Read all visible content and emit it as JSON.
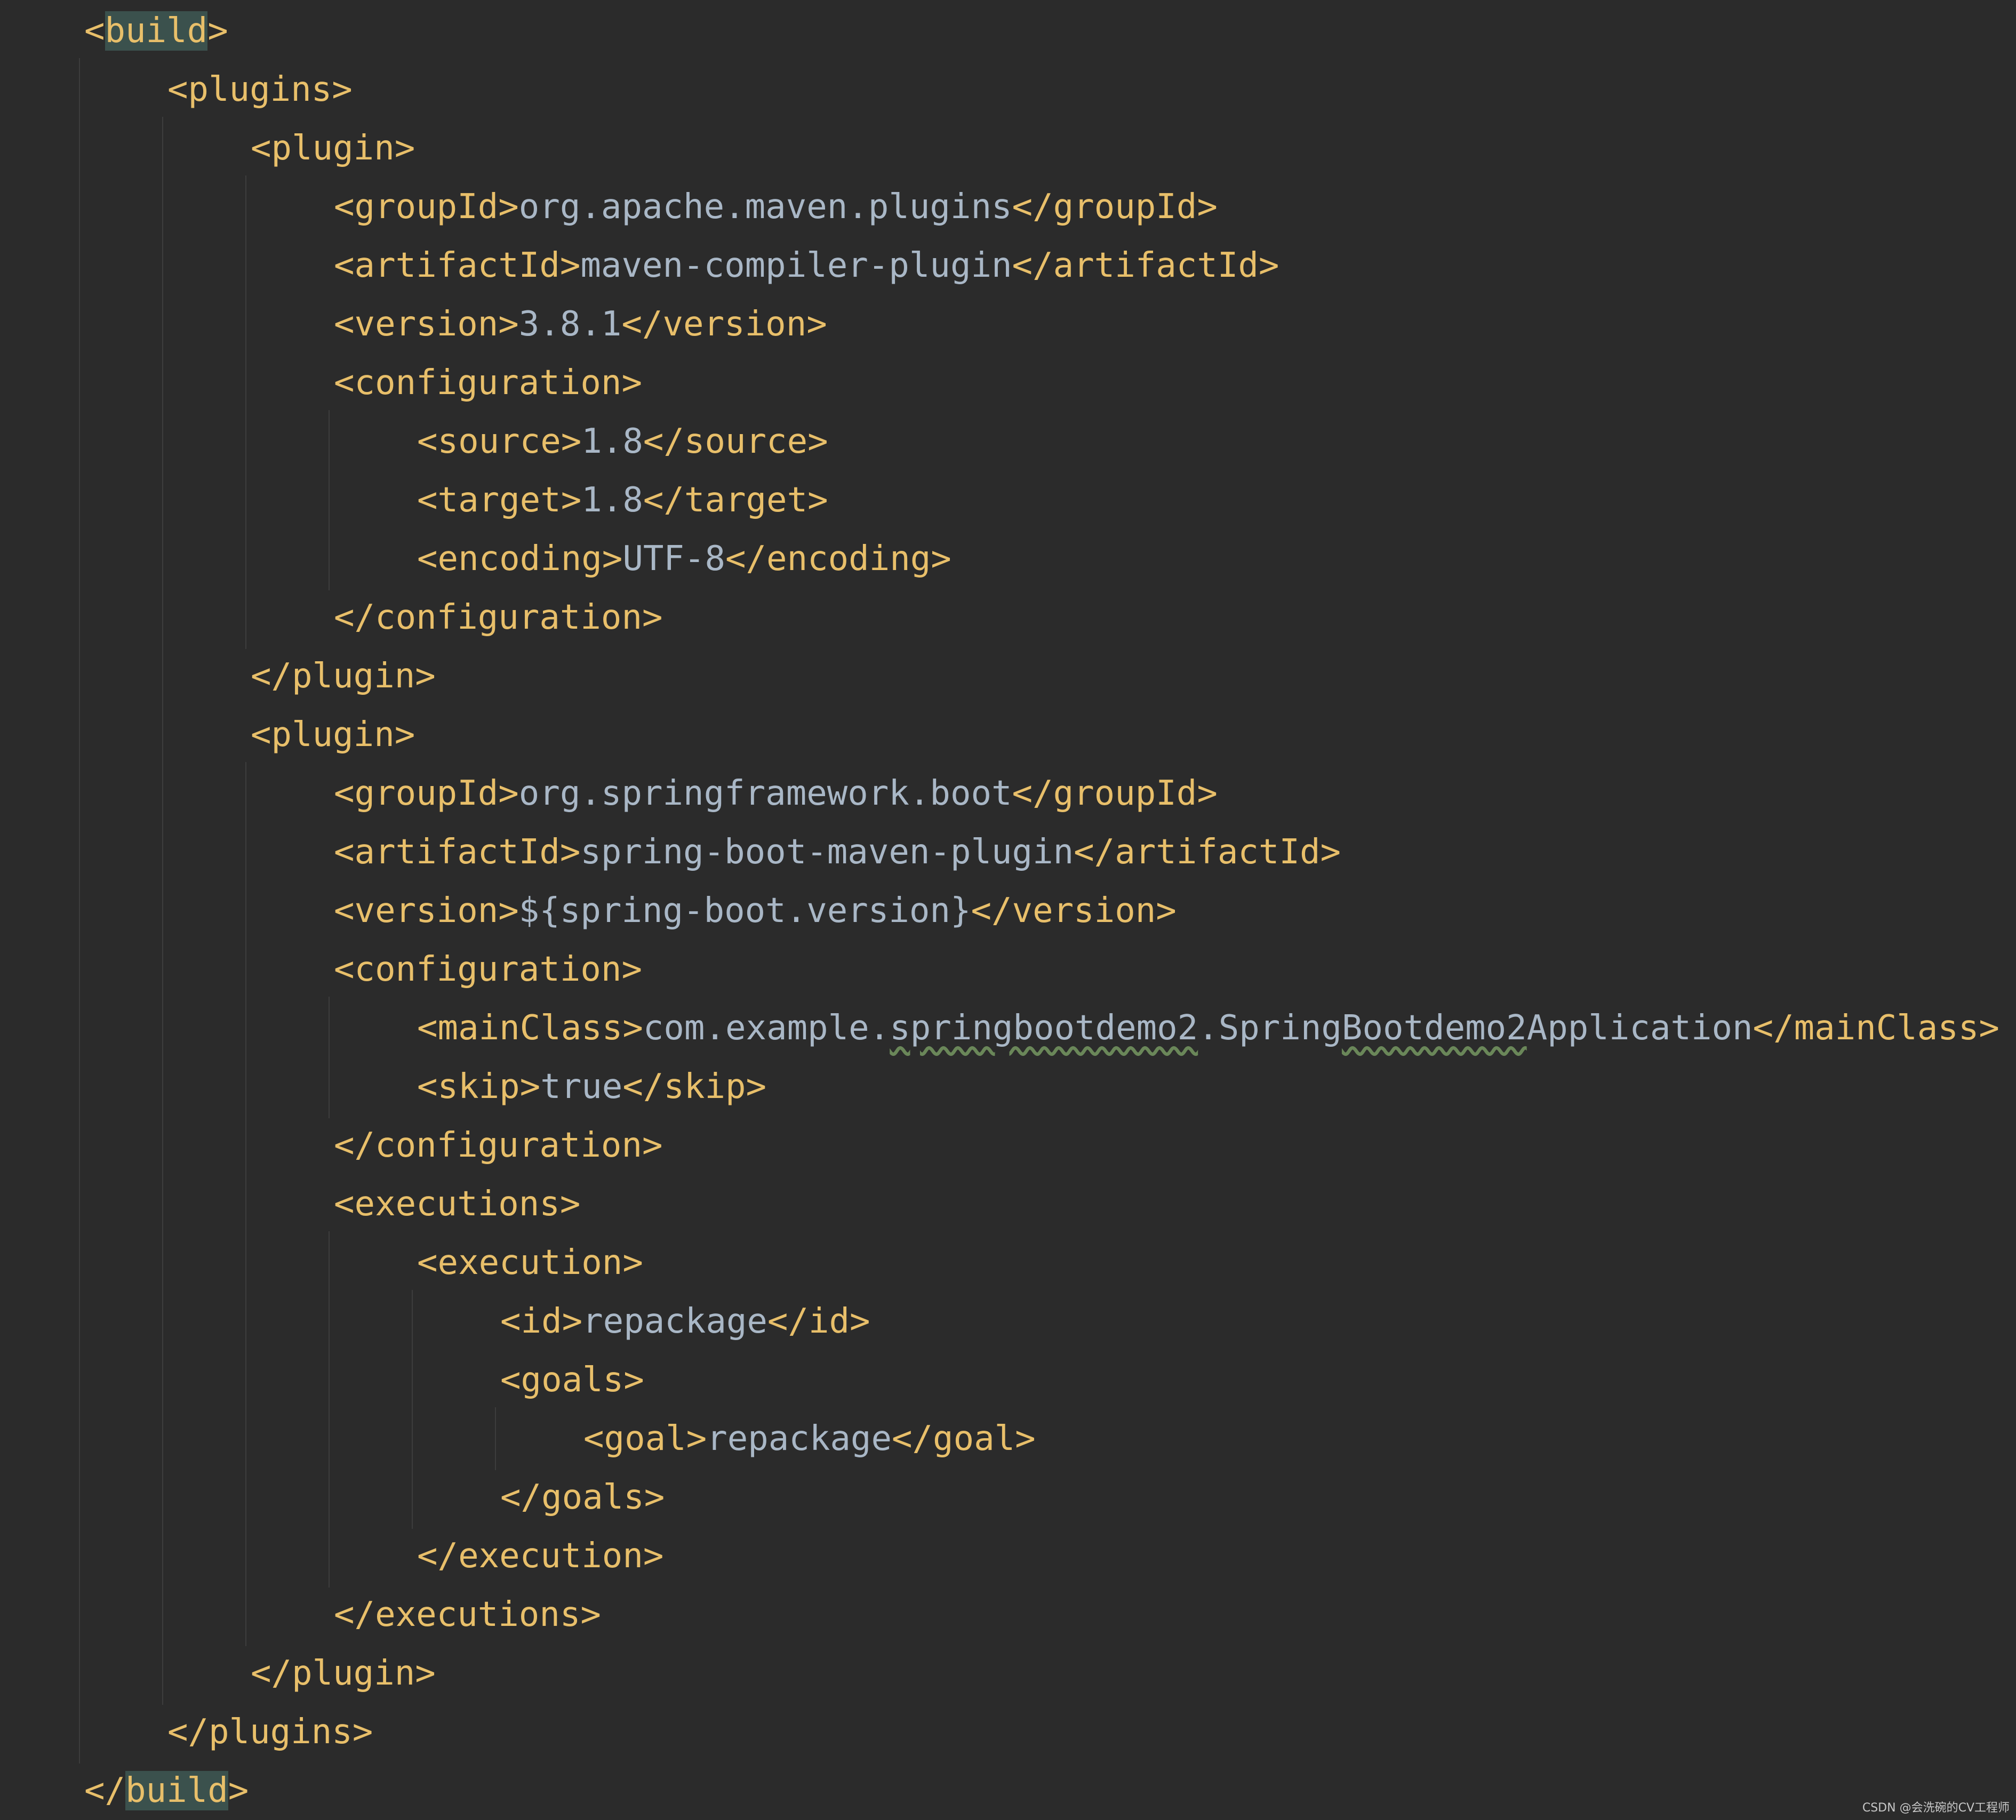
{
  "theme": {
    "background": "#2b2b2b",
    "tag_color": "#e8bf6a",
    "text_color": "#a9b7c6",
    "tag_match_highlight": "#3b514d",
    "squiggle_color": "#6a8759",
    "indent_guide_color": "#3d3d3d"
  },
  "code_lines": [
    {
      "indent": 0,
      "open_tag": "build",
      "text": "",
      "close_tag": "",
      "highlight_name": true
    },
    {
      "indent": 1,
      "open_tag": "plugins",
      "text": "",
      "close_tag": ""
    },
    {
      "indent": 2,
      "open_tag": "plugin",
      "text": "",
      "close_tag": ""
    },
    {
      "indent": 3,
      "open_tag": "groupId",
      "text": "org.apache.maven.plugins",
      "close_tag": "groupId"
    },
    {
      "indent": 3,
      "open_tag": "artifactId",
      "text": "maven-compiler-plugin",
      "close_tag": "artifactId"
    },
    {
      "indent": 3,
      "open_tag": "version",
      "text": "3.8.1",
      "close_tag": "version"
    },
    {
      "indent": 3,
      "open_tag": "configuration",
      "text": "",
      "close_tag": ""
    },
    {
      "indent": 4,
      "open_tag": "source",
      "text": "1.8",
      "close_tag": "source"
    },
    {
      "indent": 4,
      "open_tag": "target",
      "text": "1.8",
      "close_tag": "target"
    },
    {
      "indent": 4,
      "open_tag": "encoding",
      "text": "UTF-8",
      "close_tag": "encoding"
    },
    {
      "indent": 3,
      "open_tag": "",
      "text": "",
      "close_tag": "configuration"
    },
    {
      "indent": 2,
      "open_tag": "",
      "text": "",
      "close_tag": "plugin"
    },
    {
      "indent": 2,
      "open_tag": "plugin",
      "text": "",
      "close_tag": ""
    },
    {
      "indent": 3,
      "open_tag": "groupId",
      "text": "org.springframework.boot",
      "close_tag": "groupId"
    },
    {
      "indent": 3,
      "open_tag": "artifactId",
      "text": "spring-boot-maven-plugin",
      "close_tag": "artifactId"
    },
    {
      "indent": 3,
      "open_tag": "version",
      "text": "${spring-boot.version}",
      "close_tag": "version"
    },
    {
      "indent": 3,
      "open_tag": "configuration",
      "text": "",
      "close_tag": ""
    },
    {
      "indent": 4,
      "open_tag": "mainClass",
      "text": "",
      "close_tag": "mainClass",
      "segments": [
        {
          "text": "com.example.",
          "squiggle": false
        },
        {
          "text": "springbootdemo2",
          "squiggle": true
        },
        {
          "text": ".Spring",
          "squiggle": false
        },
        {
          "text": "Bootdemo2",
          "squiggle": true
        },
        {
          "text": "Application",
          "squiggle": false
        }
      ]
    },
    {
      "indent": 4,
      "open_tag": "skip",
      "text": "true",
      "close_tag": "skip"
    },
    {
      "indent": 3,
      "open_tag": "",
      "text": "",
      "close_tag": "configuration"
    },
    {
      "indent": 3,
      "open_tag": "executions",
      "text": "",
      "close_tag": ""
    },
    {
      "indent": 4,
      "open_tag": "execution",
      "text": "",
      "close_tag": ""
    },
    {
      "indent": 5,
      "open_tag": "id",
      "text": "repackage",
      "close_tag": "id"
    },
    {
      "indent": 5,
      "open_tag": "goals",
      "text": "",
      "close_tag": ""
    },
    {
      "indent": 6,
      "open_tag": "goal",
      "text": "repackage",
      "close_tag": "goal"
    },
    {
      "indent": 5,
      "open_tag": "",
      "text": "",
      "close_tag": "goals"
    },
    {
      "indent": 4,
      "open_tag": "",
      "text": "",
      "close_tag": "execution"
    },
    {
      "indent": 3,
      "open_tag": "",
      "text": "",
      "close_tag": "executions"
    },
    {
      "indent": 2,
      "open_tag": "",
      "text": "",
      "close_tag": "plugin"
    },
    {
      "indent": 1,
      "open_tag": "",
      "text": "",
      "close_tag": "plugins"
    },
    {
      "indent": 0,
      "open_tag": "",
      "text": "",
      "close_tag": "build",
      "highlight_name": true
    }
  ],
  "watermark": "CSDN @会洗碗的CV工程师"
}
